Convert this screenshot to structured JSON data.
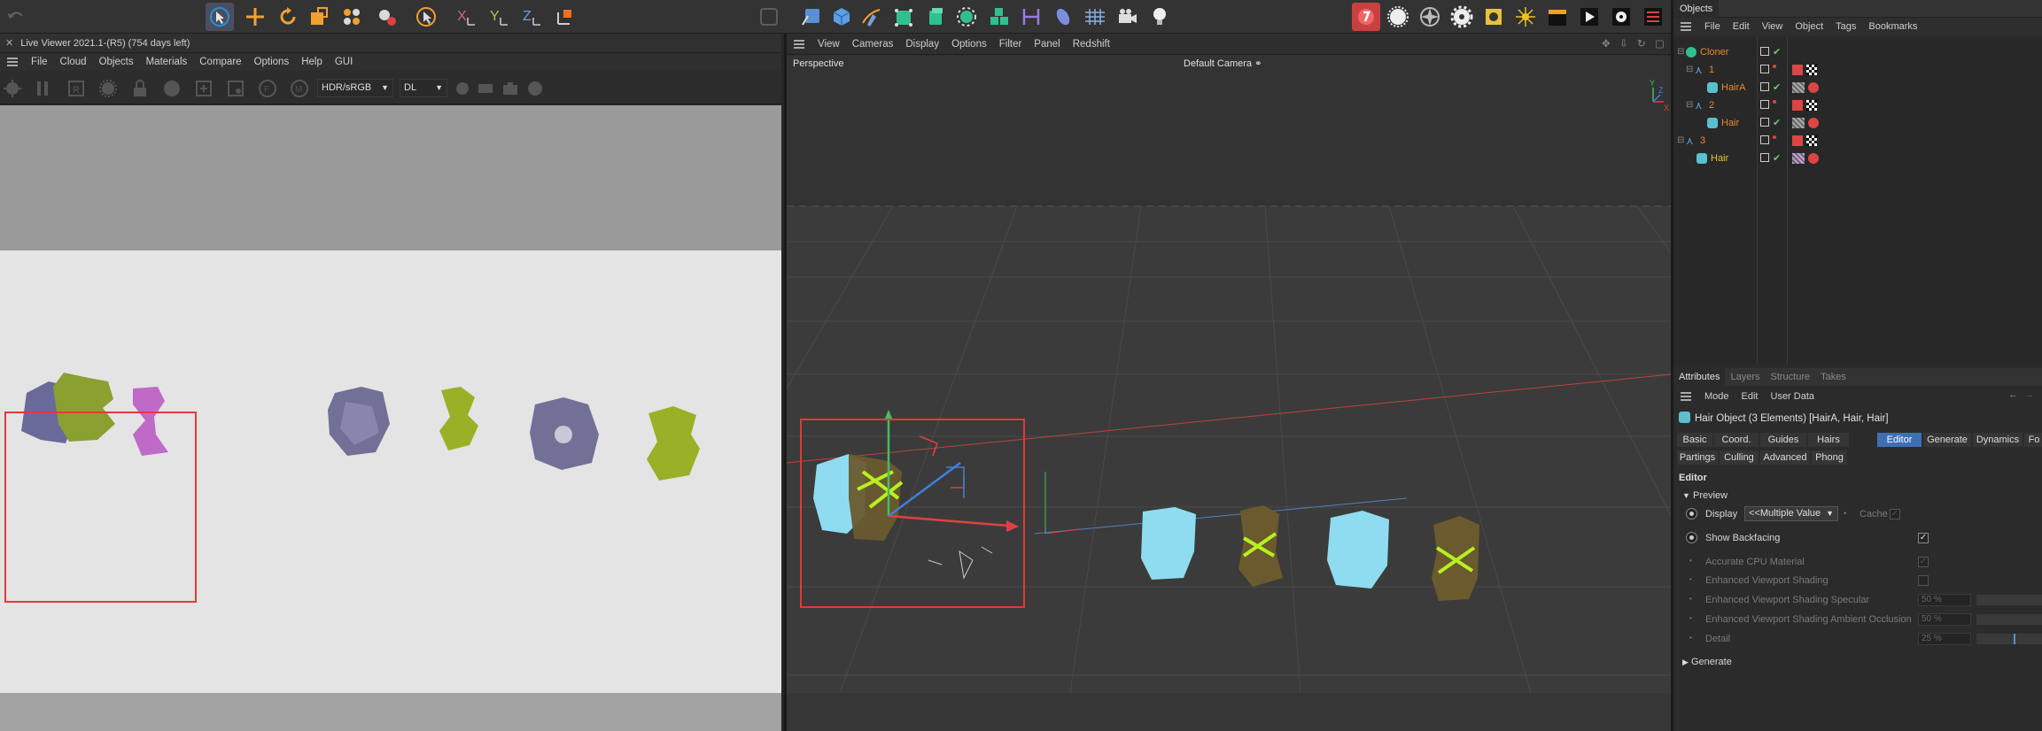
{
  "toolbar": {
    "icons_left": [
      "undo-icon",
      "live-selection-icon",
      "move-icon",
      "rotate-icon",
      "scale-icon",
      "render-region-icon",
      "object-mode-icon",
      "model-mode-icon",
      "x-axis-lock-icon",
      "y-axis-lock-icon",
      "z-axis-lock-icon",
      "world-coordinate-icon"
    ],
    "axis_labels": {
      "x": "X",
      "y": "Y",
      "z": "Z"
    },
    "icons_middle": [
      "null-icon",
      "camera-icon",
      "cube-icon",
      "spline-pen-icon",
      "subdivision-icon",
      "generator-icon",
      "cloner-icon",
      "array-icon",
      "deformer-icon",
      "capsule-icon",
      "floor-icon",
      "camera-object-icon",
      "light-icon"
    ],
    "icons_right": [
      "redshift-icon",
      "sun-icon",
      "aperture-icon",
      "gear-icon",
      "material-icon",
      "sparkle-icon",
      "clapper-icon",
      "play-render-icon",
      "render-settings-icon",
      "render-queue-icon"
    ],
    "accent": "#4a4f60"
  },
  "live_viewer": {
    "title": "Live Viewer 2021.1-(R5) (754 days left)",
    "menu": [
      "File",
      "Cloud",
      "Objects",
      "Materials",
      "Compare",
      "Options",
      "Help",
      "GUI"
    ],
    "color_space": "HDR/sRGB",
    "mode": "DL",
    "floor_color": "#e4e4e4",
    "background_color": "#9a9a9a"
  },
  "viewport": {
    "menu": [
      "View",
      "Cameras",
      "Display",
      "Options",
      "Filter",
      "Panel",
      "Redshift"
    ],
    "projection": "Perspective",
    "camera": "Default Camera"
  },
  "objects_panel": {
    "tab": "Objects",
    "menu": [
      "File",
      "Edit",
      "View",
      "Object",
      "Tags",
      "Bookmarks"
    ],
    "tree": [
      {
        "name": "Cloner",
        "type": "cloner",
        "level": 0
      },
      {
        "name": "1",
        "type": "null",
        "level": 1
      },
      {
        "name": "HairA",
        "type": "hair",
        "level": 2
      },
      {
        "name": "2",
        "type": "null",
        "level": 1
      },
      {
        "name": "Hair",
        "type": "hair",
        "level": 2
      },
      {
        "name": "3",
        "type": "null",
        "level": 0
      },
      {
        "name": "Hair",
        "type": "hair",
        "level": 1
      }
    ]
  },
  "attributes": {
    "tabs": [
      "Attributes",
      "Layers",
      "Structure",
      "Takes"
    ],
    "menu": [
      "Mode",
      "Edit",
      "User Data"
    ],
    "object_title": "Hair Object (3 Elements) [HairA, Hair, Hair]",
    "property_tabs_row1": [
      "Basic",
      "Coord.",
      "Guides",
      "Hairs",
      "Editor",
      "Generate",
      "Dynamics",
      "Fo"
    ],
    "property_tabs_row2": [
      "Partings",
      "Culling",
      "Advanced",
      "Phong"
    ],
    "active_tab": "Editor",
    "section": "Editor",
    "group_preview": "Preview",
    "display_label": "Display",
    "display_value": "<<Multiple Value",
    "cache_label": "Cache",
    "show_backfacing": "Show Backfacing",
    "accurate_cpu": "Accurate CPU Material",
    "enh_shading": "Enhanced Viewport Shading",
    "enh_specular": "Enhanced Viewport Shading Specular",
    "enh_specular_value": "50 %",
    "enh_ao": "Enhanced Viewport Shading Ambient Occlusion",
    "enh_ao_value": "50 %",
    "detail": "Detail",
    "detail_value": "25 %",
    "group_generate": "Generate"
  }
}
